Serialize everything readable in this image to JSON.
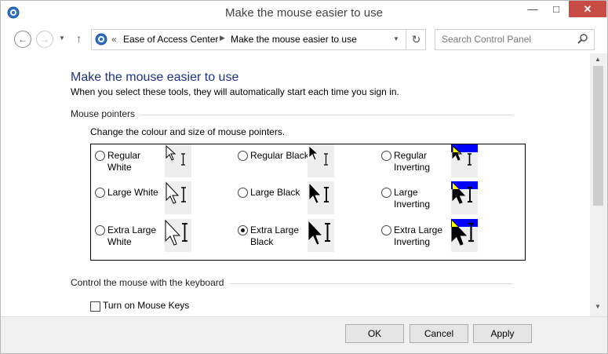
{
  "window": {
    "title": "Make the mouse easier to use",
    "minimize_glyph": "—",
    "maximize_glyph": "□",
    "close_glyph": "✕"
  },
  "nav": {
    "back_glyph": "←",
    "forward_glyph": "→",
    "recent_glyph": "▼",
    "up_glyph": "↑",
    "address_sep": "«",
    "breadcrumb": [
      "Ease of Access Center",
      "Make the mouse easier to use"
    ],
    "crumb_arrow_glyph": "▶",
    "dropdown_glyph": "▼",
    "refresh_glyph": "↻",
    "search_placeholder": "Search Control Panel"
  },
  "content": {
    "title": "Make the mouse easier to use",
    "subtitle": "When you select these tools, they will automatically start each time you sign in.",
    "mouse_pointers": {
      "heading": "Mouse pointers",
      "description": "Change the colour and size of mouse pointers.",
      "options": [
        {
          "line1": "Regular",
          "line2": "White",
          "selected": false
        },
        {
          "line1": "Regular Black",
          "line2": "",
          "selected": false
        },
        {
          "line1": "Regular",
          "line2": "Inverting",
          "selected": false
        },
        {
          "line1": "Large White",
          "line2": "",
          "selected": false
        },
        {
          "line1": "Large Black",
          "line2": "",
          "selected": false
        },
        {
          "line1": "Large",
          "line2": "Inverting",
          "selected": false
        },
        {
          "line1": "Extra Large",
          "line2": "White",
          "selected": false
        },
        {
          "line1": "Extra Large",
          "line2": "Black",
          "selected": true
        },
        {
          "line1": "Extra Large",
          "line2": "Inverting",
          "selected": false
        }
      ]
    },
    "keyboard": {
      "heading": "Control the mouse with the keyboard",
      "mouse_keys_label": "Turn on Mouse Keys",
      "mouse_keys_checked": false
    }
  },
  "scrollbar": {
    "up_glyph": "▲",
    "down_glyph": "▼"
  },
  "buttons": {
    "ok": "OK",
    "cancel": "Cancel",
    "apply": "Apply"
  },
  "colors": {
    "title_blue": "#1e3287",
    "close_red": "#c74b43",
    "inverting_blue": "#0000ff",
    "inverting_yellow": "#ffff00"
  }
}
